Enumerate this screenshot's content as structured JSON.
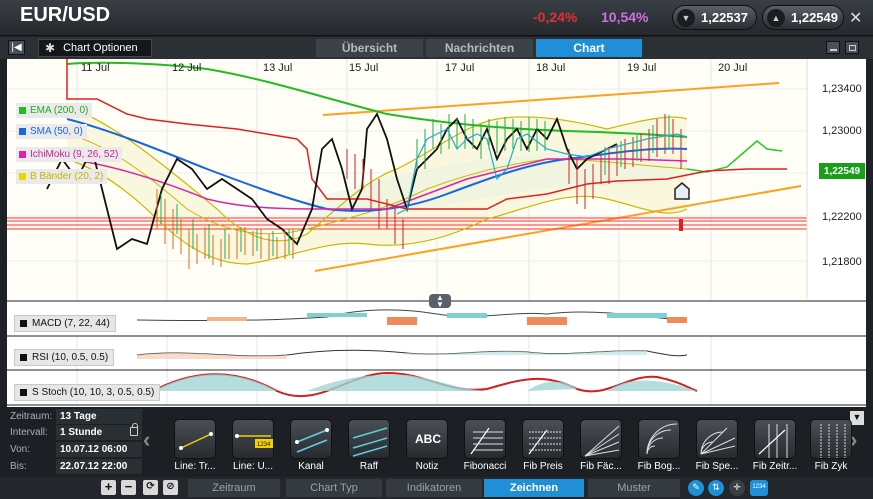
{
  "header": {
    "symbol": "EUR/USD",
    "change_pct": "-0,24%",
    "vol_pct": "10,54%",
    "sell_price": "1,22537",
    "buy_price": "1,22549"
  },
  "toolbar": {
    "chart_options_label": "Chart Optionen",
    "tabs": [
      "Übersicht",
      "Nachrichten",
      "Chart"
    ],
    "active_tab": "Chart"
  },
  "chart": {
    "x_labels": [
      "11 Jul",
      "12 Jul",
      "13 Jul",
      "15 Jul",
      "17 Jul",
      "18 Jul",
      "19 Jul",
      "20 Jul"
    ],
    "y_labels": [
      "1,23400",
      "1,23000",
      "1,22200",
      "1,21800"
    ],
    "last_price": "1,22549",
    "legend": [
      {
        "label": "EMA (200, 0)",
        "color": "#22bb22"
      },
      {
        "label": "SMA (50, 0)",
        "color": "#1a66dd"
      },
      {
        "label": "IchiMoku (9, 26, 52)",
        "color": "#dd22aa"
      },
      {
        "label": "B Bänder (20, 2)",
        "color": "#e8d800"
      }
    ],
    "indicators": [
      {
        "label": "MACD (7, 22, 44)"
      },
      {
        "label": "RSI (10, 0.5, 0.5)"
      },
      {
        "label": "S Stoch (10, 10, 3, 0.5, 0.5)"
      }
    ]
  },
  "info": {
    "rows": [
      {
        "key": "Zeitraum:",
        "value": "13 Tage"
      },
      {
        "key": "Intervall:",
        "value": "1 Stunde"
      },
      {
        "key": "Von:",
        "value": "10.07.12 06:00"
      },
      {
        "key": "Bis:",
        "value": "22.07.12 22:00"
      }
    ]
  },
  "tools": [
    {
      "label": "Line: Tr...",
      "icon": "trendline-icon"
    },
    {
      "label": "Line: U...",
      "icon": "line-value-icon"
    },
    {
      "label": "Kanal",
      "icon": "channel-icon"
    },
    {
      "label": "Raff",
      "icon": "raff-channel-icon"
    },
    {
      "label": "Notiz",
      "icon": "note-icon",
      "text": "ABC"
    },
    {
      "label": "Fibonacci",
      "icon": "fibonacci-icon"
    },
    {
      "label": "Fib Preis",
      "icon": "fib-price-icon"
    },
    {
      "label": "Fib Fäc...",
      "icon": "fib-fan-icon"
    },
    {
      "label": "Fib Bog...",
      "icon": "fib-arc-icon"
    },
    {
      "label": "Fib Spe...",
      "icon": "fib-speed-icon"
    },
    {
      "label": "Fib Zeitr...",
      "icon": "fib-time-icon"
    },
    {
      "label": "Fib Zyk",
      "icon": "fib-cycle-icon"
    }
  ],
  "tool_value_badge": "1234",
  "bottom_tabs": [
    "Zeitraum",
    "Chart Typ",
    "Indikatoren",
    "Zeichnen",
    "Muster"
  ],
  "active_bottom_tab": "Zeichnen",
  "colors": {
    "accent": "#1f8fd8",
    "negative": "#e03030",
    "vol": "#d070e0",
    "last_price_bg": "#1a9e1a"
  }
}
